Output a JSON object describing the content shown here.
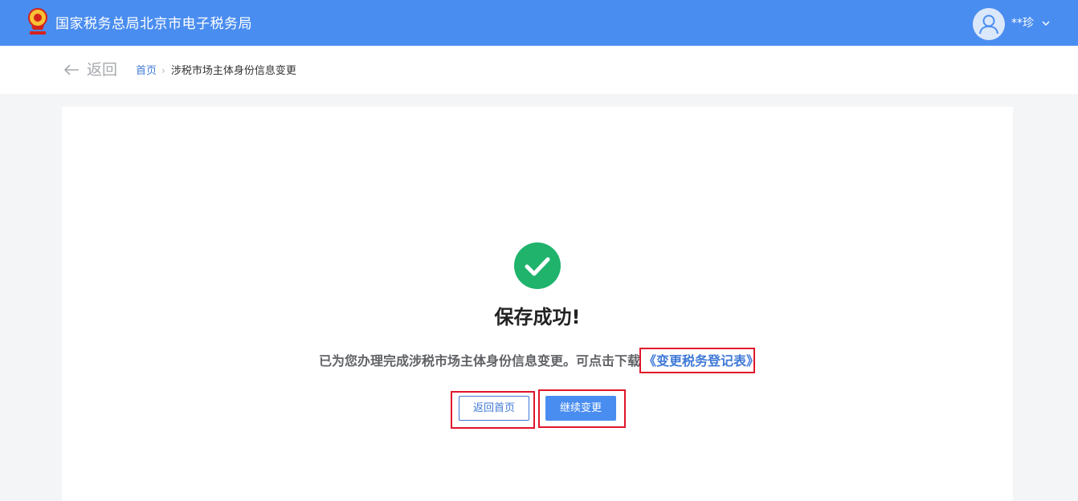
{
  "header": {
    "site_title": "国家税务总局北京市电子税务局",
    "username": "**珍",
    "logo_icon": "tax-emblem-icon",
    "avatar_icon": "user-avatar-icon",
    "menu_icon": "chevron-down-icon"
  },
  "navigation": {
    "back_label": "返回",
    "back_icon": "arrow-left-icon",
    "breadcrumb": {
      "home": "首页",
      "separator": "›",
      "current": "涉税市场主体身份信息变更"
    }
  },
  "result": {
    "status_icon": "check-circle-icon",
    "title": "保存成功!",
    "message": "已为您办理完成涉税市场主体身份信息变更。可点击下载",
    "download_link": "《变更税务登记表》",
    "buttons": {
      "home": "返回首页",
      "continue": "继续变更"
    }
  },
  "colors": {
    "header_bg": "#4a8df0",
    "link": "#3f79d7",
    "success": "#1fb36b",
    "highlight_box": "#e0152b",
    "page_bg": "#f4f5f7"
  }
}
